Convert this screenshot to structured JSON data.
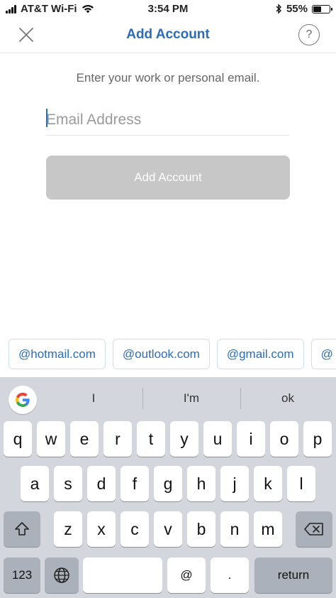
{
  "status_bar": {
    "carrier": "AT&T Wi-Fi",
    "time": "3:54 PM",
    "battery": "55%",
    "battery_level": 0.55,
    "icons": [
      "signal-bars-icon",
      "wifi-icon",
      "bluetooth-icon",
      "battery-icon"
    ]
  },
  "nav": {
    "title": "Add Account",
    "close_icon": "close-icon",
    "help_label": "?"
  },
  "form": {
    "prompt": "Enter your work or personal email.",
    "email_placeholder": "Email Address",
    "email_value": "",
    "submit_label": "Add Account",
    "submit_enabled": false
  },
  "suggestions": [
    "@hotmail.com",
    "@outlook.com",
    "@gmail.com",
    "@"
  ],
  "keyboard": {
    "predictions": [
      "I",
      "I'm",
      "ok"
    ],
    "row1": [
      "q",
      "w",
      "e",
      "r",
      "t",
      "y",
      "u",
      "i",
      "o",
      "p"
    ],
    "row2": [
      "a",
      "s",
      "d",
      "f",
      "g",
      "h",
      "j",
      "k",
      "l"
    ],
    "row3": [
      "z",
      "x",
      "c",
      "v",
      "b",
      "n",
      "m"
    ],
    "numbers_label": "123",
    "at_label": "@",
    "dot_label": ".",
    "return_label": "return",
    "space_label": ""
  },
  "colors": {
    "accent": "#2b6cb8",
    "button_disabled": "#c7c7c7",
    "keyboard_bg": "#d3d6dc",
    "key_dark": "#abb1ba"
  }
}
